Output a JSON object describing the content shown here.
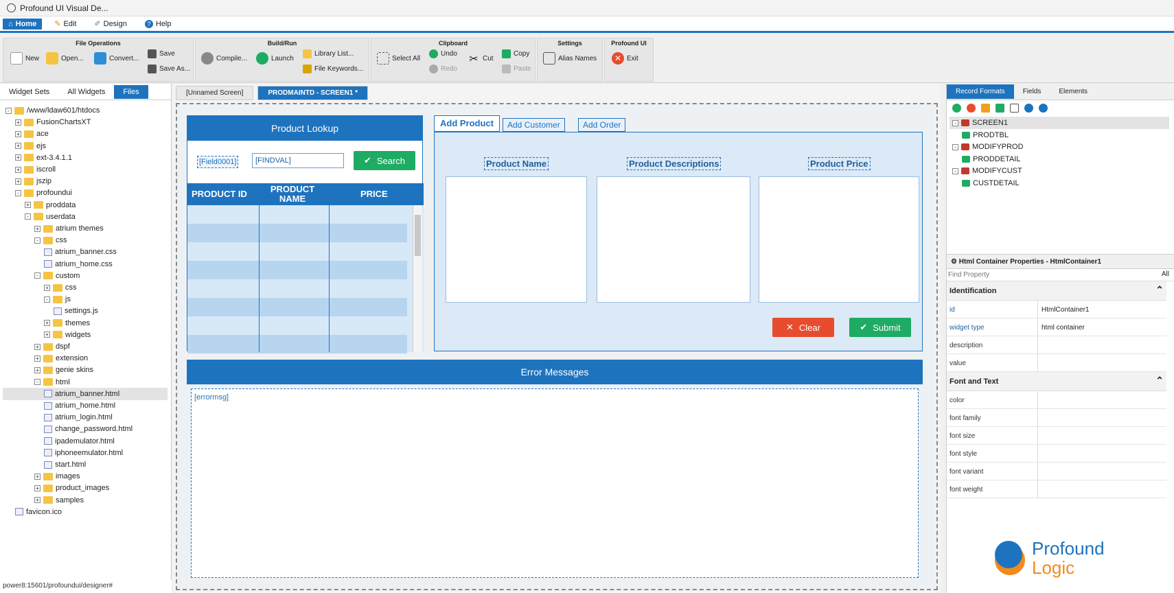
{
  "window": {
    "title": "Profound UI Visual De..."
  },
  "menu": {
    "items": [
      "Home",
      "Edit",
      "Design",
      "Help"
    ]
  },
  "ribbon": {
    "file_ops": {
      "title": "File Operations",
      "new": "New",
      "open": "Open...",
      "convert": "Convert...",
      "save": "Save",
      "save_as": "Save As..."
    },
    "build": {
      "title": "Build/Run",
      "compile": "Compile...",
      "launch": "Launch",
      "library": "Library List...",
      "keywords": "File Keywords..."
    },
    "clipboard": {
      "title": "Clipboard",
      "select_all": "Select All",
      "undo": "Undo",
      "redo": "Redo",
      "cut": "Cut",
      "copy": "Copy",
      "paste": "Paste"
    },
    "settings": {
      "title": "Settings",
      "alias": "Alias Names"
    },
    "profound": {
      "title": "Profound UI",
      "exit": "Exit"
    }
  },
  "left": {
    "tabs": [
      "Widget Sets",
      "All Widgets",
      "Files"
    ],
    "tree": [
      "/www/ldaw601/htdocs",
      "FusionChartsXT",
      "ace",
      "ejs",
      "ext-3.4.1.1",
      "iscroll",
      "jszip",
      "profoundui",
      "proddata",
      "userdata",
      "atrium themes",
      "css",
      "atrium_banner.css",
      "atrium_home.css",
      "custom",
      "css",
      "js",
      "settings.js",
      "themes",
      "widgets",
      "dspf",
      "extension",
      "genie skins",
      "html",
      "atrium_banner.html",
      "atrium_home.html",
      "atrium_login.html",
      "change_password.html",
      "ipademulator.html",
      "iphoneemulator.html",
      "start.html",
      "images",
      "product_images",
      "samples",
      "favicon.ico"
    ],
    "status": "power8:15601/profoundui/designer#"
  },
  "center": {
    "tabs": [
      "[Unnamed Screen]",
      "PRODMAINTD - SCREEN1 *"
    ],
    "lookup": {
      "title": "Product Lookup",
      "field_label": "[Field0001]",
      "find_value": "[FINDVAL]",
      "search": "Search",
      "col_id": "PRODUCT ID",
      "col_name": "PRODUCT NAME",
      "col_price": "PRICE"
    },
    "tabpanel": {
      "tabs": [
        "Add Product",
        "Add Customer",
        "Add Order"
      ],
      "label_name": "Product Name",
      "label_desc": "Product Descriptions",
      "label_price": "Product Price",
      "clear": "Clear",
      "submit": "Submit"
    },
    "errors": {
      "title": "Error Messages",
      "field": "[errormsg]"
    }
  },
  "right": {
    "tabs": [
      "Record Formats",
      "Fields",
      "Elements"
    ],
    "formats": [
      "SCREEN1",
      "PRODTBL",
      "MODIFYPROD",
      "PRODDETAIL",
      "MODIFYCUST",
      "CUSTDETAIL"
    ],
    "props_title": "Html Container Properties - HtmlContainer1",
    "find_placeholder": "Find Property",
    "all": "All",
    "sec_ident": "Identification",
    "sec_font": "Font and Text",
    "props": [
      {
        "k": "id",
        "v": "HtmlContainer1"
      },
      {
        "k": "widget type",
        "v": "html container"
      },
      {
        "k": "description",
        "v": ""
      },
      {
        "k": "value",
        "v": ""
      }
    ],
    "font_props": [
      "color",
      "font family",
      "font size",
      "font style",
      "font variant",
      "font weight"
    ],
    "logo_top": "Profound",
    "logo_bottom": "Logic"
  },
  "colors": {
    "accent": "#1e73be",
    "search": "#1eab63",
    "clear": "#e84c2e",
    "logo_orange": "#f28a1e"
  }
}
